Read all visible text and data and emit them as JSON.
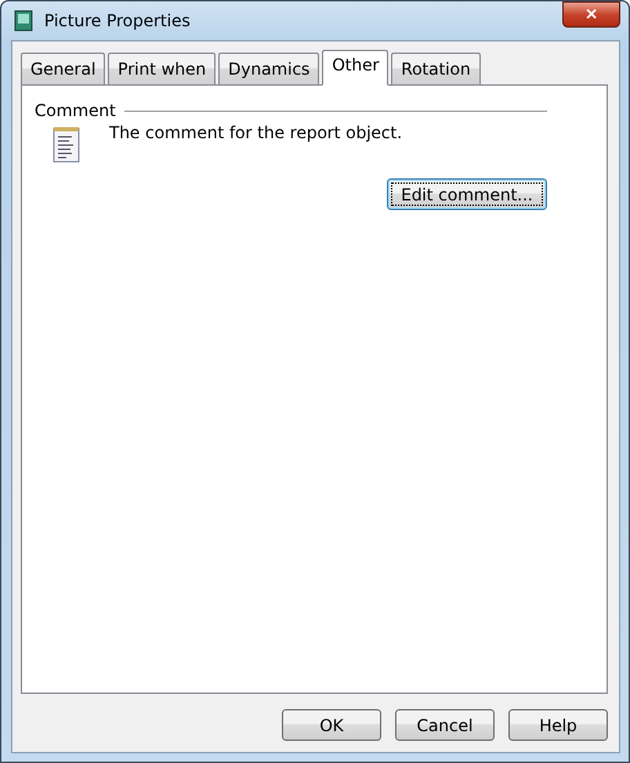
{
  "window": {
    "title": "Picture Properties",
    "close": "✕"
  },
  "tabs": [
    {
      "label": "General",
      "selected": false
    },
    {
      "label": "Print when",
      "selected": false
    },
    {
      "label": "Dynamics",
      "selected": false
    },
    {
      "label": "Other",
      "selected": true
    },
    {
      "label": "Rotation",
      "selected": false
    }
  ],
  "comment_group": {
    "title": "Comment",
    "description": "The comment for the report object.",
    "button": "Edit comment..."
  },
  "buttons": [
    "OK",
    "Cancel",
    "Help"
  ]
}
